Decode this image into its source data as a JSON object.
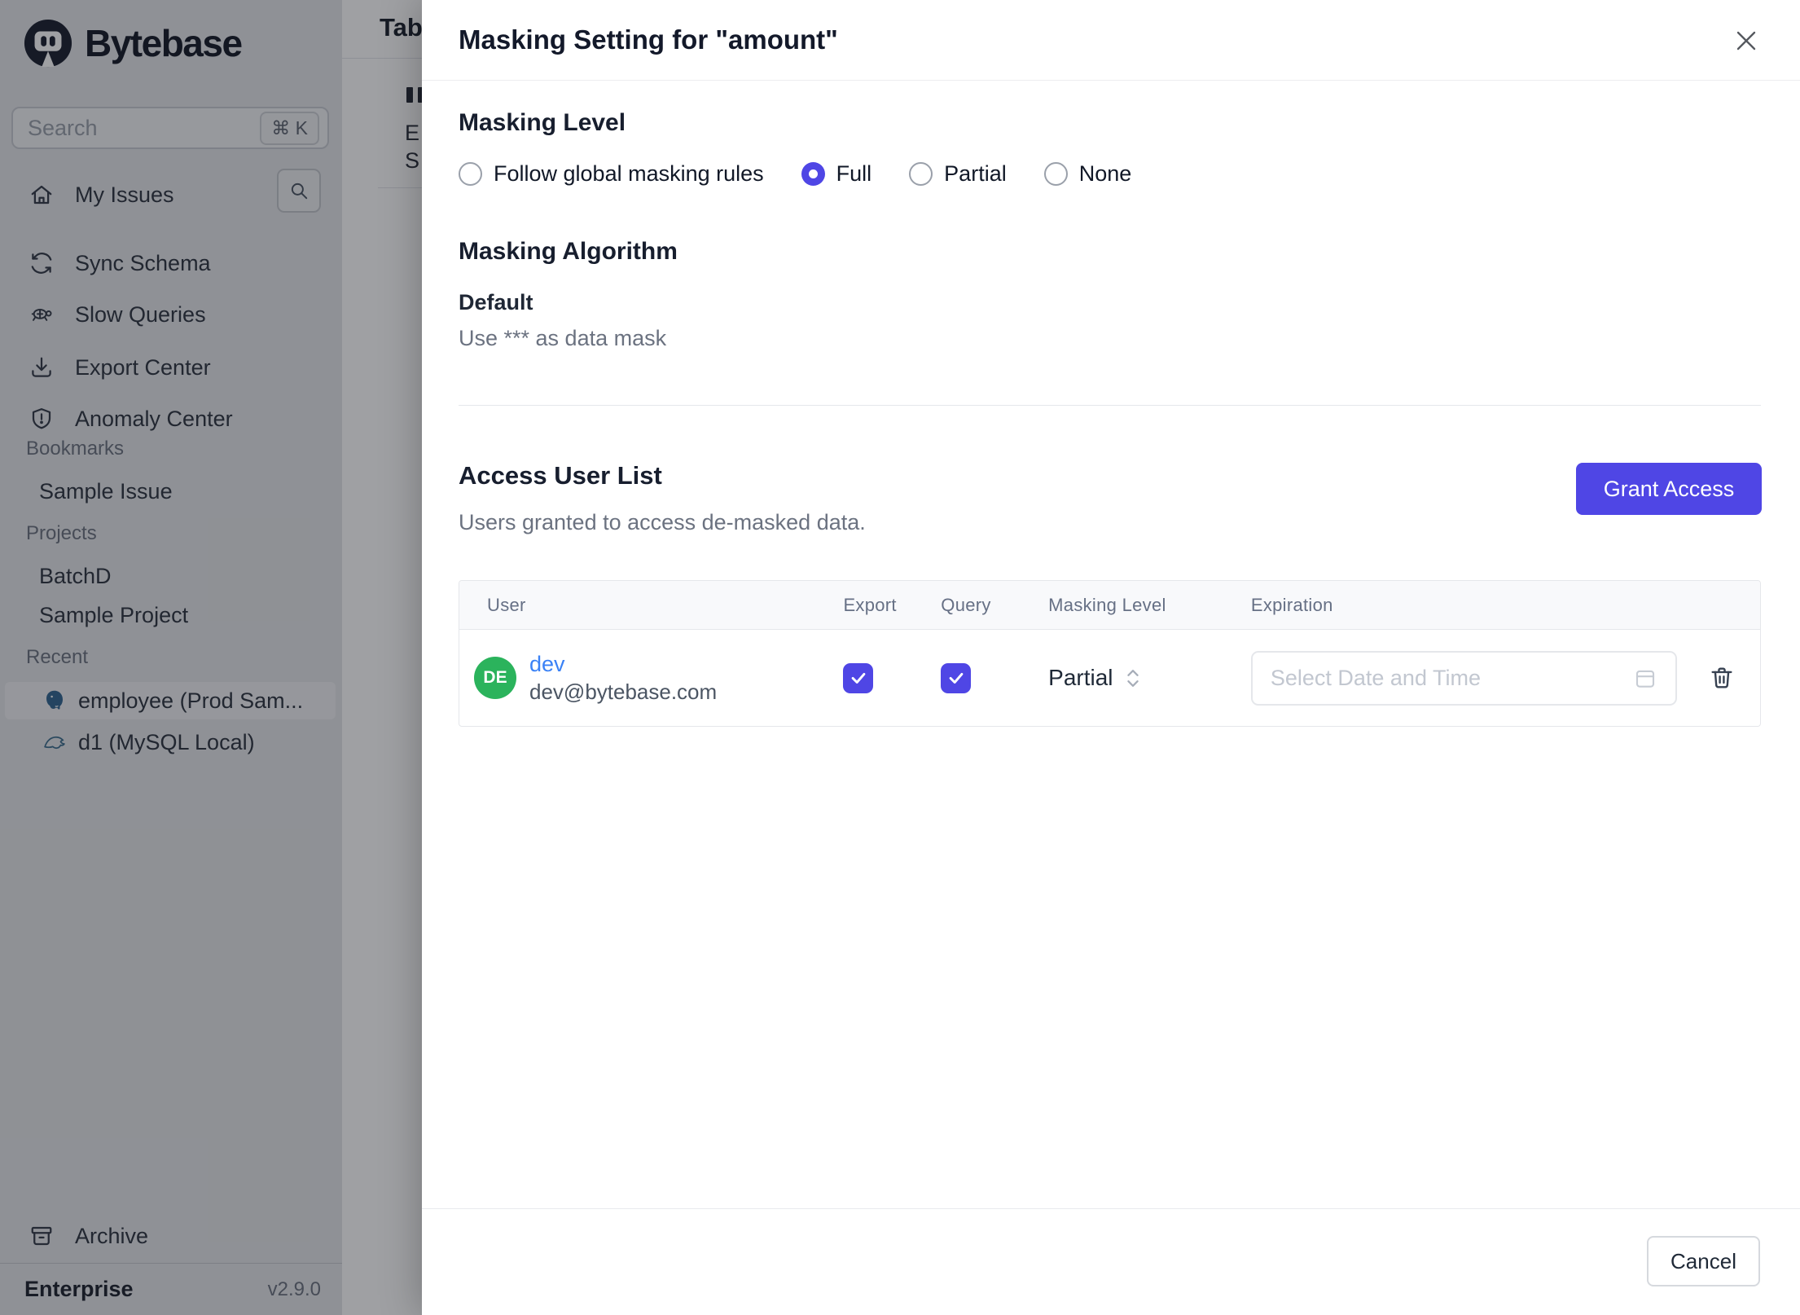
{
  "sidebar": {
    "logo_text": "Bytebase",
    "search": {
      "placeholder": "Search",
      "shortcut": "⌘ K"
    },
    "nav": [
      {
        "icon": "home-icon",
        "label": "My Issues"
      },
      {
        "icon": "sync-icon",
        "label": "Sync Schema"
      },
      {
        "icon": "turtle-icon",
        "label": "Slow Queries"
      },
      {
        "icon": "download-icon",
        "label": "Export Center"
      },
      {
        "icon": "shield-icon",
        "label": "Anomaly Center"
      }
    ],
    "sections": [
      {
        "title": "Bookmarks",
        "items": [
          {
            "label": "Sample Issue"
          }
        ]
      },
      {
        "title": "Projects",
        "items": [
          {
            "label": "BatchD"
          },
          {
            "label": "Sample Project"
          }
        ]
      },
      {
        "title": "Recent",
        "items": [
          {
            "icon": "postgres-icon",
            "label": "employee (Prod Sam...",
            "active": true
          },
          {
            "icon": "mysql-icon",
            "label": "d1 (MySQL Local)",
            "active": false
          }
        ]
      }
    ],
    "archive_label": "Archive",
    "plan": "Enterprise",
    "version": "v2.9.0"
  },
  "background_page": {
    "title_fragment": "Tab",
    "fragment_row1": "E",
    "fragment_row2": "S"
  },
  "modal": {
    "title": "Masking Setting for \"amount\"",
    "masking_level": {
      "heading": "Masking Level",
      "options": [
        {
          "label": "Follow global masking rules",
          "selected": false
        },
        {
          "label": "Full",
          "selected": true
        },
        {
          "label": "Partial",
          "selected": false
        },
        {
          "label": "None",
          "selected": false
        }
      ]
    },
    "masking_algorithm": {
      "heading": "Masking Algorithm",
      "name": "Default",
      "description": "Use *** as data mask"
    },
    "access_user_list": {
      "heading": "Access User List",
      "subtitle": "Users granted to access de-masked data.",
      "grant_button_label": "Grant Access",
      "table": {
        "columns": [
          "User",
          "Export",
          "Query",
          "Masking Level",
          "Expiration"
        ],
        "rows": [
          {
            "avatar_initials": "DE",
            "username": "dev",
            "email": "dev@bytebase.com",
            "export_checked": true,
            "query_checked": true,
            "masking_level": "Partial",
            "expiration_placeholder": "Select Date and Time"
          }
        ]
      }
    },
    "footer": {
      "cancel_label": "Cancel"
    }
  },
  "colors": {
    "accent": "#4f46e5",
    "avatar_green": "#2bb35c",
    "link_blue": "#3b82f6",
    "logo_navy": "#1b2130"
  }
}
